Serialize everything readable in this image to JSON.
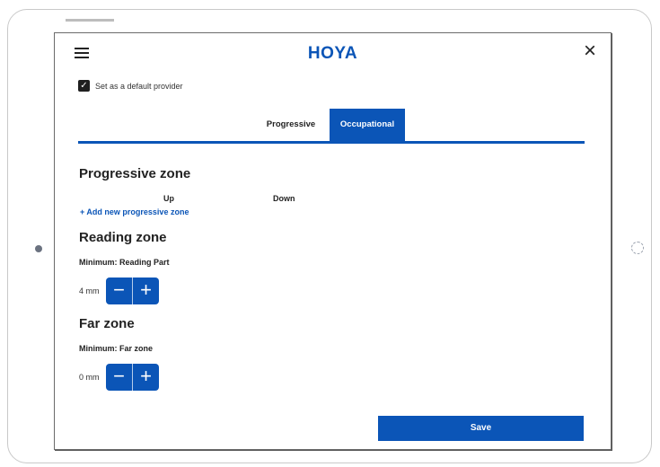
{
  "header": {
    "logo": "HOYA"
  },
  "default_provider": {
    "label": "Set as a default provider",
    "checked": true
  },
  "tabs": [
    {
      "label": "Progressive",
      "active": false
    },
    {
      "label": "Occupational",
      "active": true
    }
  ],
  "progressive_zone": {
    "title": "Progressive zone",
    "col_up": "Up",
    "col_down": "Down",
    "add_link": "+ Add new progressive zone"
  },
  "reading_zone": {
    "title": "Reading zone",
    "minimum_label": "Minimum: Reading Part",
    "value": "4 mm"
  },
  "far_zone": {
    "title": "Far zone",
    "minimum_label": "Minimum: Far zone",
    "value": "0 mm"
  },
  "save_label": "Save",
  "colors": {
    "accent": "#0b55b7"
  }
}
